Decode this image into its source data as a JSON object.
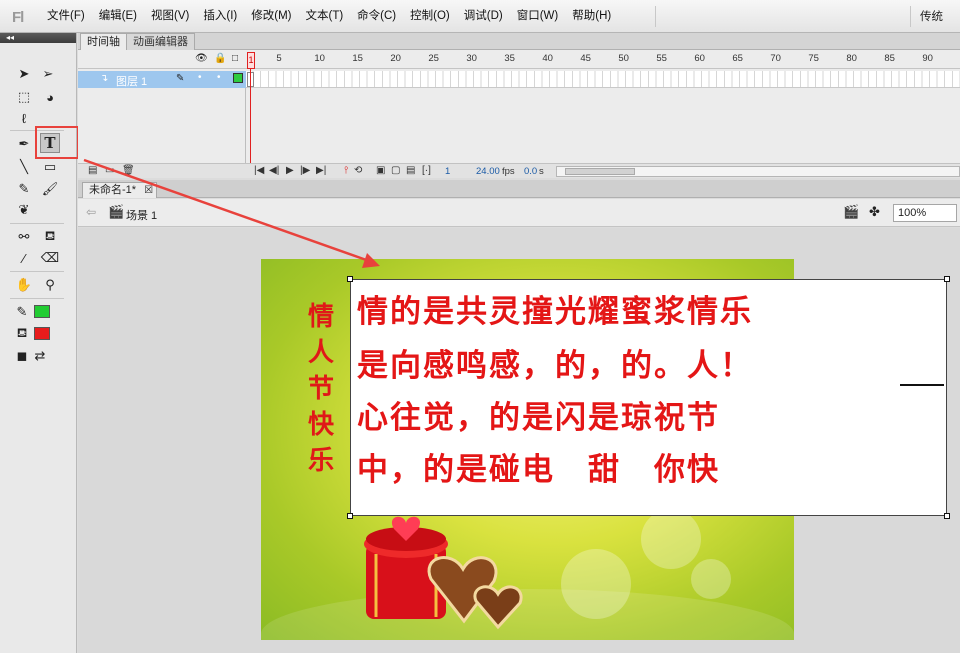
{
  "app": {
    "logo": "Fl"
  },
  "menu": {
    "items": [
      "文件(F)",
      "编辑(E)",
      "视图(V)",
      "插入(I)",
      "修改(M)",
      "文本(T)",
      "命令(C)",
      "控制(O)",
      "调试(D)",
      "窗口(W)",
      "帮助(H)"
    ],
    "workspace": "传统"
  },
  "toolspanel": {
    "collapse": "◂◂"
  },
  "timeline": {
    "tabs": [
      "时间轴",
      "动画编辑器"
    ],
    "ruler": [
      "1",
      "5",
      "10",
      "15",
      "20",
      "25",
      "30",
      "35",
      "40",
      "45",
      "50",
      "55",
      "60",
      "65",
      "70",
      "75",
      "80",
      "85",
      "90"
    ],
    "layer_name": "图层 1",
    "current_frame": "1",
    "fps": "24.00",
    "fps_unit": "fps",
    "elapsed": "0.0",
    "elapsed_unit": "s"
  },
  "document": {
    "tab_title": "未命名-1*",
    "scene": "场景 1",
    "zoom": "100%"
  },
  "stage": {
    "vertical_text": [
      "情",
      "人",
      "节",
      "快",
      "乐"
    ],
    "textbox_lines": [
      "情的是共灵撞光耀蜜浆情乐",
      "是向感鸣感，的，的。人！",
      "心往觉，的是闪是琼祝节",
      "中，的是碰电　甜　你快"
    ]
  },
  "colors": {
    "stroke_color": "#22cc33",
    "fill_color": "#e81c1c",
    "text_color": "#e41616",
    "highlight": "#e8423c"
  }
}
